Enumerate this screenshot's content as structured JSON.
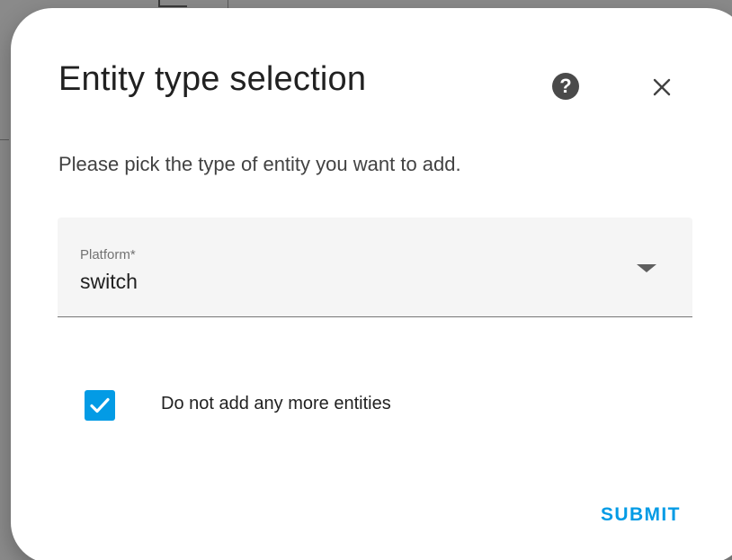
{
  "dialog": {
    "title": "Entity type selection",
    "description": "Please pick the type of entity you want to add.",
    "help_icon": "help-circle-icon",
    "close_icon": "close-icon",
    "help_glyph": "?"
  },
  "platform_select": {
    "label": "Platform*",
    "value": "switch",
    "arrow_icon": "dropdown-arrow-icon"
  },
  "checkbox": {
    "label": "Do not add any more entities",
    "checked": true,
    "icon": "checkmark-icon"
  },
  "actions": {
    "submit_label": "SUBMIT"
  },
  "colors": {
    "accent": "#039be5",
    "title_text": "#212121",
    "secondary_text": "#737373",
    "field_background": "#f5f5f5",
    "help_icon_background": "#4a4a4a"
  }
}
